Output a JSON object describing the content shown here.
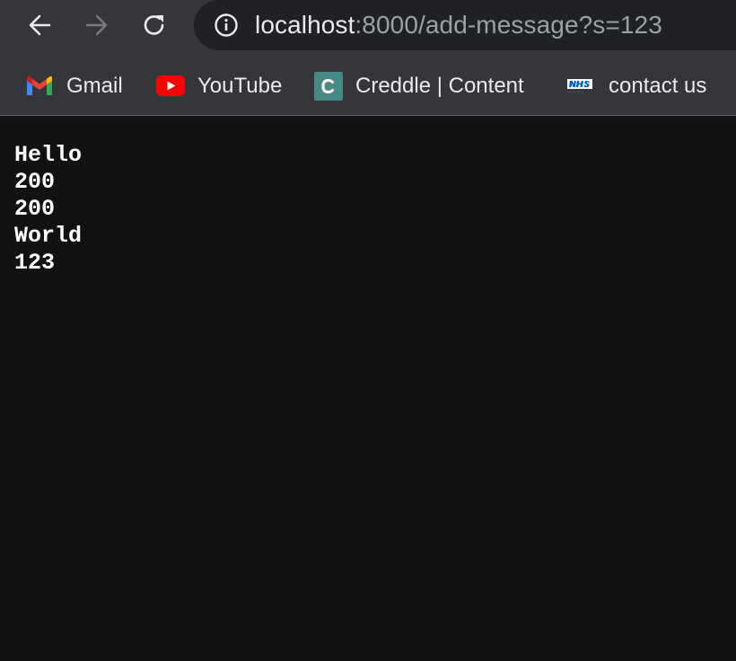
{
  "browser": {
    "url_host": "localhost",
    "url_rest": ":8000/add-message?s=123",
    "back_icon": "back-arrow-icon",
    "forward_icon": "forward-arrow-icon",
    "reload_icon": "reload-icon",
    "info_icon": "info-icon"
  },
  "bookmarks": [
    {
      "label": "Gmail",
      "icon": "gmail-icon"
    },
    {
      "label": "YouTube",
      "icon": "youtube-icon"
    },
    {
      "label": "Creddle | Content",
      "icon": "creddle-icon"
    },
    {
      "label": "contact us",
      "icon": "nhs-icon"
    }
  ],
  "page": {
    "lines": [
      "Hello",
      "200",
      "200",
      "World",
      "123"
    ]
  }
}
